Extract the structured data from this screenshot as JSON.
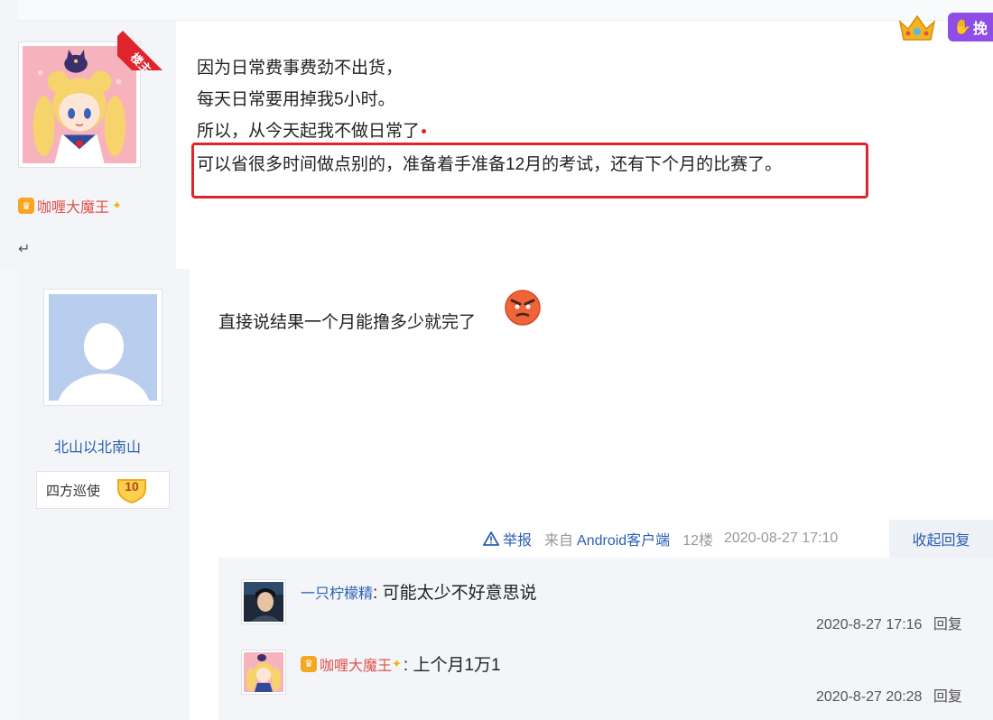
{
  "post1": {
    "ribbon_label": "楼主",
    "username": "咖喱大魔王",
    "lines": [
      "因为日常费事费劲不出货，",
      "每天日常要用掉我5小时。",
      "所以，从今天起我不做日常了",
      "可以省很多时间做点别的，准备着手准备12月的考试，还有下个月的比赛了。"
    ],
    "type_badge": "挽",
    "return_symbol": "↵"
  },
  "post2": {
    "username": "北山以北南山",
    "rank_title": "四方巡使",
    "level": "10",
    "text": "直接说结果一个月能撸多少就完了",
    "tail": {
      "report": "举报",
      "source_prefix": "来自",
      "source_client": "Android客户端",
      "floor": "12楼",
      "timestamp": "2020-08-27 17:10",
      "collapse": "收起回复"
    },
    "replies": [
      {
        "user": "一只柠檬精",
        "text": ": 可能太少不好意思说",
        "time": "2020-8-27 17:16",
        "reply": "回复"
      },
      {
        "user": "咖喱大魔王",
        "text": ": 上个月1万1",
        "time": "2020-8-27 20:28",
        "reply": "回复"
      }
    ]
  },
  "colors": {
    "accent_link": "#2b5fb3",
    "highlight_frame": "#e1242a",
    "username_red": "#e0524a",
    "purple_badge": "#8d4de6"
  }
}
